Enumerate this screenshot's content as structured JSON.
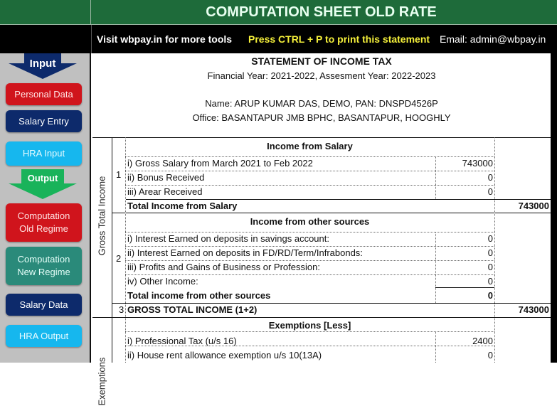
{
  "header": {
    "title": "COMPUTATION SHEET OLD RATE",
    "visit_text": "Visit wbpay.in for more tools",
    "print_hint": "Press CTRL + P to print this statement",
    "email": "Email: admin@wbpay.in"
  },
  "sidebar": {
    "input_label": "Input",
    "output_label": "Output",
    "buttons": [
      {
        "label": "Personal Data",
        "color": "#d0141c"
      },
      {
        "label": "Salary Entry",
        "color": "#0d2a6b"
      },
      {
        "label": "HRA Input",
        "color": "#16b7ee"
      },
      {
        "label": "Computation Old Regime",
        "line1": "Computation",
        "line2": "Old Regime",
        "color": "#d0141c"
      },
      {
        "label": "Computation New Regime",
        "line1": "Computation",
        "line2": "New Regime",
        "color": "#2a8a7a"
      },
      {
        "label": "Salary Data",
        "color": "#0d2a6b"
      },
      {
        "label": "HRA Output",
        "color": "#16b7ee"
      }
    ]
  },
  "statement": {
    "title": "STATEMENT OF INCOME TAX",
    "years": "Financial Year: 2021-2022,  Assesment Year: 2022-2023",
    "name_pan": "Name: ARUP KUMAR DAS, DEMO,   PAN: DNSPD4526P",
    "office": "Office: BASANTAPUR JMB BPHC, BASANTAPUR, HOOGHLY",
    "section_label_gti": "Gross Total Income",
    "section_label_exemptions": "Exemptions",
    "salary": {
      "no": "1",
      "heading": "Income from Salary",
      "rows": [
        {
          "label": "i) Gross Salary from March 2021 to Feb 2022",
          "value": "743000"
        },
        {
          "label": "ii) Bonus Received",
          "value": "0"
        },
        {
          "label": "iii) Arear Received",
          "value": "0"
        }
      ],
      "total_label": "Total Income from Salary",
      "total_value": "743000"
    },
    "other": {
      "no": "2",
      "heading": "Income from other sources",
      "rows": [
        {
          "label": "i) Interest Earned on deposits in savings account:",
          "value": "0"
        },
        {
          "label": "ii) Interest Earned on deposits in FD/RD/Term/Infrabonds:",
          "value": "0"
        },
        {
          "label": "iii) Profits and Gains of Business or Profession:",
          "value": "0"
        },
        {
          "label": "iv) Other Income:",
          "value": "0"
        }
      ],
      "total_label": "Total income from other sources",
      "total_value": "0"
    },
    "gross": {
      "no": "3",
      "label": "GROSS TOTAL INCOME (1+2)",
      "value": "743000"
    },
    "exemptions": {
      "heading": "Exemptions [Less]",
      "rows": [
        {
          "label": "i) Professional Tax (u/s 16)",
          "value": "2400"
        },
        {
          "label": "ii) House rent allowance exemption u/s 10(13A)",
          "value": "0"
        }
      ]
    }
  }
}
